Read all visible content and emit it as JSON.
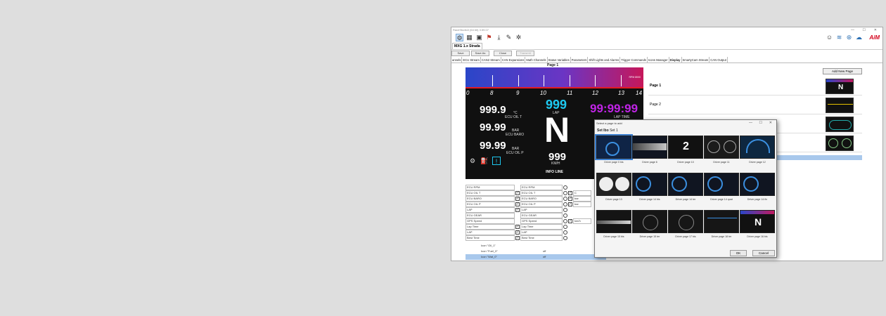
{
  "window": {
    "title": "RaceStudio3 (64 bit) 3.59.07",
    "min": "—",
    "max": "☐",
    "close": "✕"
  },
  "toolbar": {
    "icons": [
      "device-icon",
      "grid-icon",
      "image-icon",
      "alert-icon",
      "download-icon",
      "wrench-icon",
      "settings-icon"
    ],
    "right_icons": [
      "user-icon",
      "wifi-icon",
      "network-icon",
      "cloud-icon"
    ],
    "brand": "AiM"
  },
  "doc_tab": "MXG 1.x Strada",
  "actions": [
    {
      "label": "Save",
      "enabled": true
    },
    {
      "label": "Save As",
      "enabled": true
    },
    {
      "label": "Close",
      "enabled": true
    },
    {
      "label": "Transmit",
      "enabled": false
    }
  ],
  "tabs": [
    "annels",
    "ECU Stream",
    "CAN2 Stream",
    "CAN Expansions",
    "Math Channels",
    "Status Variables",
    "Parameters",
    "Shift Lights and Alarms",
    "Trigger Commands",
    "Icons Manager",
    "Display",
    "SmartyCam Stream",
    "CAN Output"
  ],
  "active_tab": "Display",
  "page_label": "Page 1",
  "dash": {
    "rpm_ticks": [
      "0",
      "8",
      "9",
      "10",
      "11",
      "12",
      "13",
      "14"
    ],
    "rpm_tag": "RPM 8000",
    "lap_value": "999",
    "lap_label": "LAP",
    "lap_time_value": "99:99:99",
    "lap_time_label": "LAP TIME",
    "gear": "N",
    "speed_value": "999",
    "speed_unit": "KM/H",
    "info_line": "INFO LINE",
    "left": [
      {
        "value": "999.9",
        "unit": "°C",
        "label": "ECU OIL T"
      },
      {
        "value": "99.99",
        "unit": "BAR",
        "label": "ECU BARO"
      },
      {
        "value": "99.99",
        "unit": "BAR",
        "label": "ECU OIL P"
      }
    ],
    "bottom_icons": [
      "engine-icon",
      "fuel-icon",
      "warning-icon"
    ]
  },
  "grid": {
    "rows": [
      {
        "name": "ECU RPM",
        "src": "ECU RPM",
        "chk1": false,
        "chk2": false,
        "unit": ""
      },
      {
        "name": "ECU OIL T",
        "src": "ECU OIL T",
        "chk1": true,
        "chk2": true,
        "unit": "C"
      },
      {
        "name": "ECU BARO",
        "src": "ECU BARO",
        "chk1": true,
        "chk2": true,
        "unit": "bar"
      },
      {
        "name": "ECU OIL P",
        "src": "ECU OIL P",
        "chk1": true,
        "chk2": true,
        "unit": "bar"
      },
      {
        "name": "LAP",
        "src": "LAP",
        "chk1": true,
        "chk2": false,
        "unit": ""
      },
      {
        "name": "ECU GEAR",
        "src": "ECU GEAR",
        "chk1": false,
        "chk2": false,
        "unit": ""
      },
      {
        "name": "GPS Speed",
        "src": "GPS Speed",
        "chk1": false,
        "chk2": true,
        "unit": "km/h"
      },
      {
        "name": "Lap Time",
        "src": "Lap Time",
        "chk1": true,
        "chk2": false,
        "unit": ""
      },
      {
        "name": "LAP",
        "src": "LAP",
        "chk1": true,
        "chk2": false,
        "unit": ""
      },
      {
        "name": "Best Time",
        "src": "Best Time",
        "chk1": true,
        "chk2": false,
        "unit": ""
      }
    ],
    "icon_rows": [
      {
        "label": "Icon \"Oil_1\"",
        "value": ""
      },
      {
        "label": "Icon \"Fuel_0\"",
        "value": "off"
      },
      {
        "label": "Icon \"Wat_0\"",
        "value": "off"
      }
    ]
  },
  "page_list": {
    "add_button": "Add New Page",
    "pages": [
      {
        "name": "Page 1",
        "bold": true
      },
      {
        "name": "Page 2",
        "bold": false
      },
      {
        "name": "",
        "bold": false
      },
      {
        "name": "",
        "bold": false
      }
    ]
  },
  "dialog": {
    "title": "Select a page to add",
    "set_label": "Set lbo",
    "set_value": "Set 1",
    "items": [
      "Driver page 0 bis",
      "Driver page 6",
      "Driver page 10",
      "Driver page 11",
      "Driver page 12",
      "Driver page 13",
      "Driver page 14 bis",
      "Driver page 14 ter",
      "Driver page 14 quat",
      "Driver page 14 fin",
      "Driver page 15 bis",
      "Driver page 15 ter",
      "Driver page 17 bis",
      "Driver page 18 ter",
      "Driver page 16 bis"
    ],
    "ok": "OK",
    "cancel": "Cancel"
  },
  "colors": {
    "rpm_start": "#2a46c8",
    "rpm_end": "#c6175a",
    "lap": "#1ec8f0",
    "lap_time": "#c024e6",
    "brand": "#d4001a",
    "selection": "#a8c8ec"
  }
}
